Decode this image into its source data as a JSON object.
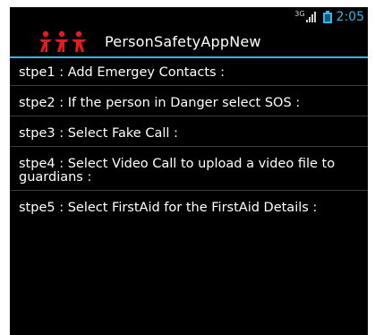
{
  "status_bar": {
    "network_label": "3G",
    "time": "2:05",
    "signal_icon": "signal-bars-icon",
    "battery_icon": "battery-icon"
  },
  "action_bar": {
    "title": "PersonSafetyAppNew",
    "logo_icon": "people-group-logo-icon",
    "accent_color": "#33b5e5"
  },
  "steps": [
    {
      "text": "stpe1 : Add Emergey Contacts :"
    },
    {
      "text": "stpe2 : If the person in Danger select SOS :"
    },
    {
      "text": "stpe3 : Select Fake Call :"
    },
    {
      "text": "stpe4 : Select Video Call to upload a video file to guardians :"
    },
    {
      "text": "stpe5 : Select FirstAid for the FirstAid Details :"
    }
  ]
}
